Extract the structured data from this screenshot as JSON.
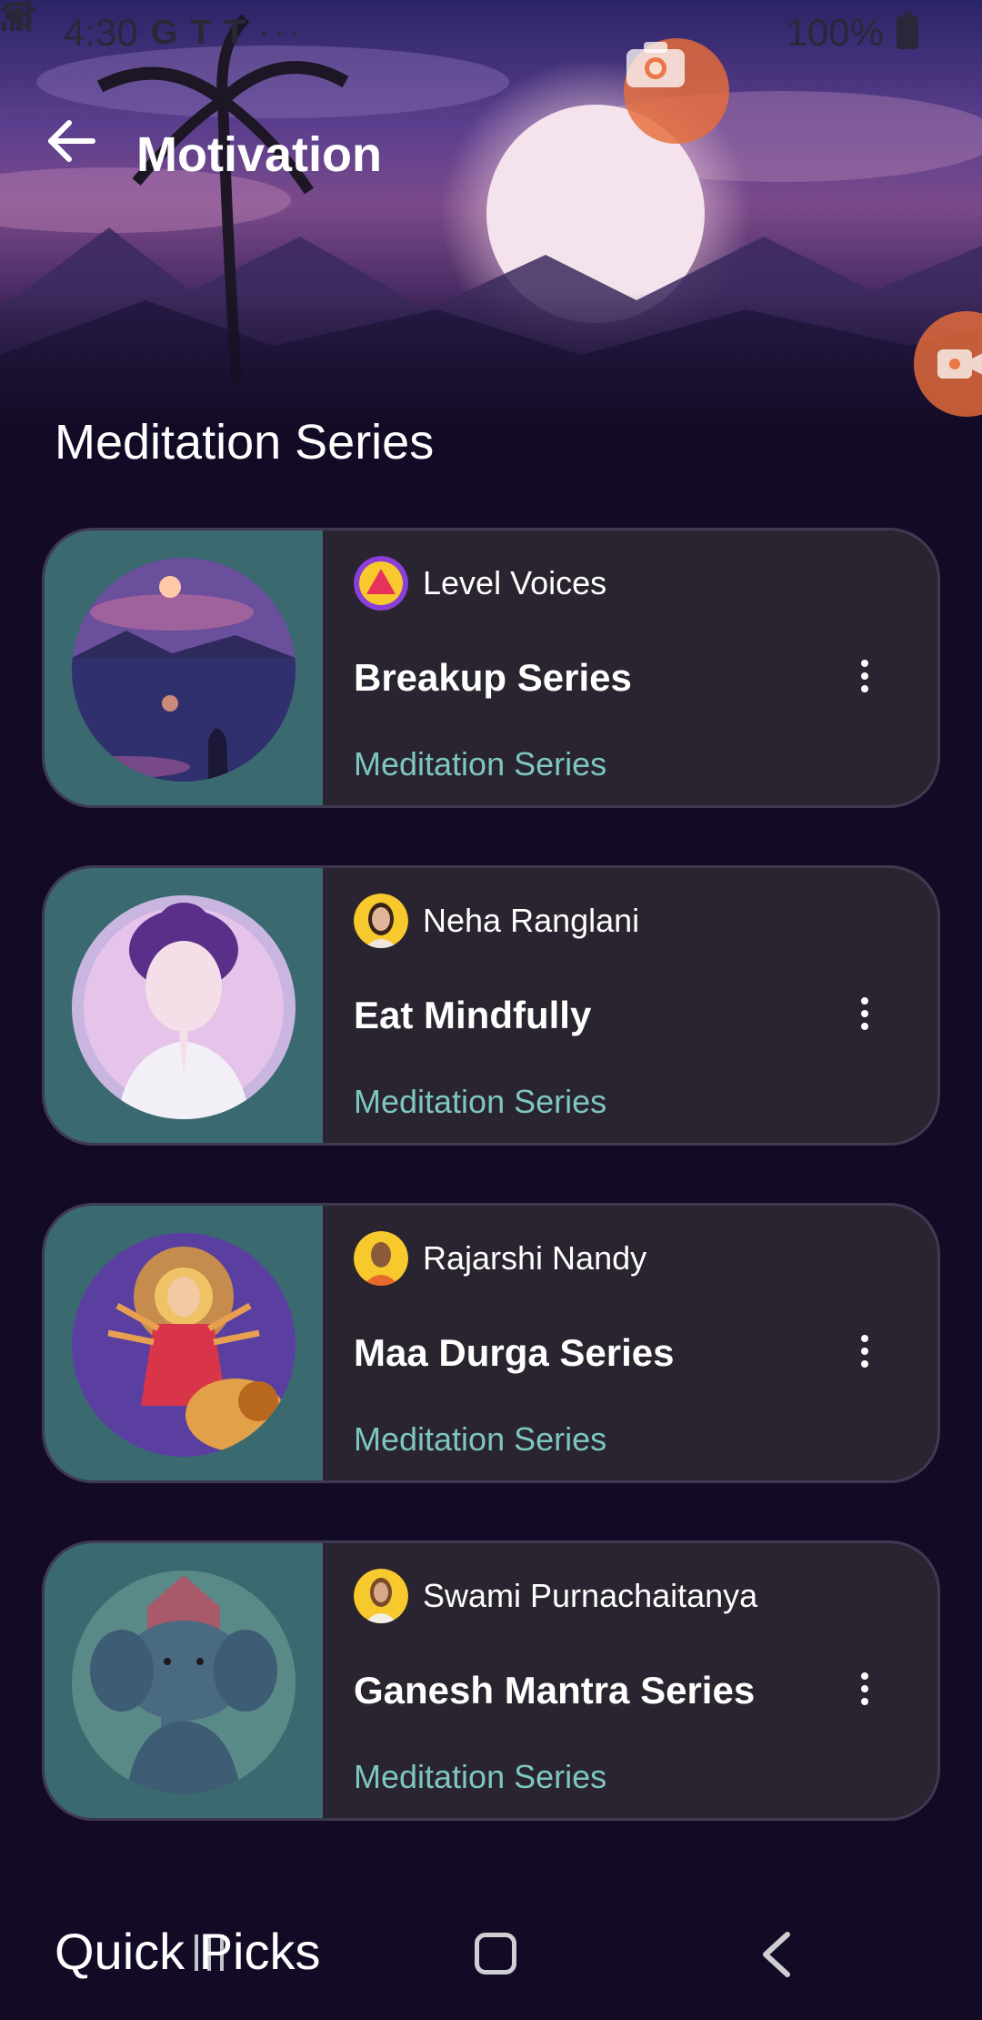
{
  "status_bar": {
    "time": "4:30",
    "left_icons": [
      "google-icon",
      "teams-icon",
      "teams-icon",
      "more-dots-icon"
    ],
    "right_icons": [
      "mute-icon",
      "wifi-icon",
      "signal-icon",
      "battery-icon"
    ],
    "battery": "100%"
  },
  "header": {
    "title": "Motivation"
  },
  "section": {
    "title": "Meditation Series"
  },
  "cards": [
    {
      "author": "Level Voices",
      "title": "Breakup Series",
      "subtitle": "Meditation Series"
    },
    {
      "author": "Neha Ranglani",
      "title": "Eat Mindfully",
      "subtitle": "Meditation Series"
    },
    {
      "author": "Rajarshi Nandy",
      "title": "Maa Durga Series",
      "subtitle": "Meditation Series"
    },
    {
      "author": "Swami Purnachaitanya",
      "title": "Ganesh Mantra Series",
      "subtitle": "Meditation Series"
    }
  ],
  "quick_picks": {
    "title": "Quick Picks"
  },
  "colors": {
    "background": "#130b26",
    "card": "#29242f",
    "card_art": "#3a6a70",
    "subtitle": "#7ec6c0",
    "fab": "#e86e3a"
  },
  "nav": {
    "icons": [
      "recents-icon",
      "home-icon",
      "back-nav-icon"
    ]
  }
}
